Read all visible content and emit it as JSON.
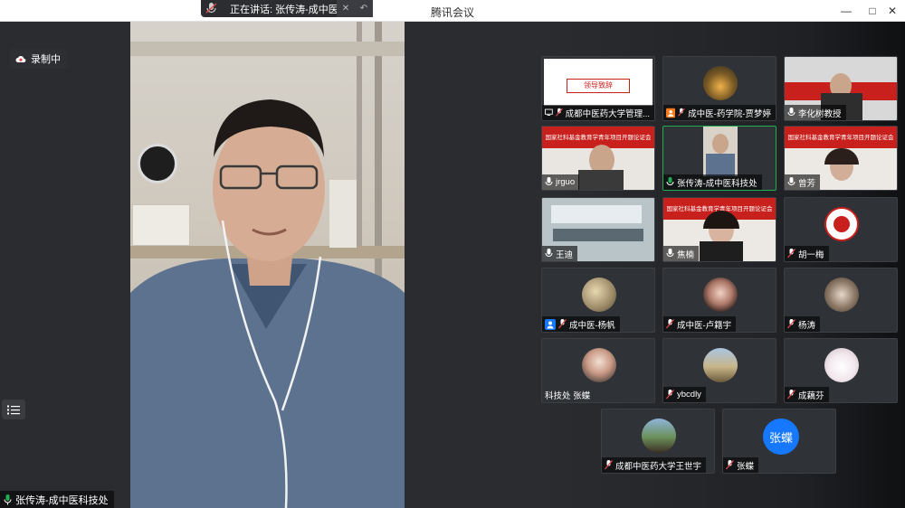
{
  "window": {
    "title": "腾讯会议",
    "speaking": "正在讲话: 张传涛-成中医..."
  },
  "main": {
    "recording_label": "录制中",
    "speaker_name": "张传涛-成中医科技处"
  },
  "participants": [
    {
      "name": "成都中医药大学管理...",
      "kind": "share"
    },
    {
      "name": "成中医-药学院-贾梦婷",
      "kind": "avatar"
    },
    {
      "name": "李化树教授",
      "kind": "video"
    },
    {
      "name": "jrguo",
      "kind": "video"
    },
    {
      "name": "张传涛-成中医科技处",
      "kind": "video"
    },
    {
      "name": "曾芳",
      "kind": "video"
    },
    {
      "name": "王迪",
      "kind": "video"
    },
    {
      "name": "焦楠",
      "kind": "video"
    },
    {
      "name": "胡一梅",
      "kind": "avatar"
    },
    {
      "name": "成中医-杨帆",
      "kind": "avatar"
    },
    {
      "name": "成中医-卢籍宇",
      "kind": "avatar"
    },
    {
      "name": "杨涛",
      "kind": "avatar"
    },
    {
      "name": "科技处 张蝶",
      "kind": "avatar"
    },
    {
      "name": "ybcdly",
      "kind": "avatar"
    },
    {
      "name": "成藕芬",
      "kind": "avatar"
    },
    {
      "name": "成都中医药大学王世宇",
      "kind": "avatar"
    },
    {
      "name": "张蝶",
      "kind": "avatar"
    }
  ],
  "tile_texts": {
    "share_heading": "领导致辞",
    "banner": "国家社科基金教育学青年项目开题论证会",
    "blue_avatar": "张蝶"
  },
  "colors": {
    "active_border": "#1fae51",
    "banner_red": "#c8201d",
    "avatar_blue": "#1677ff"
  }
}
